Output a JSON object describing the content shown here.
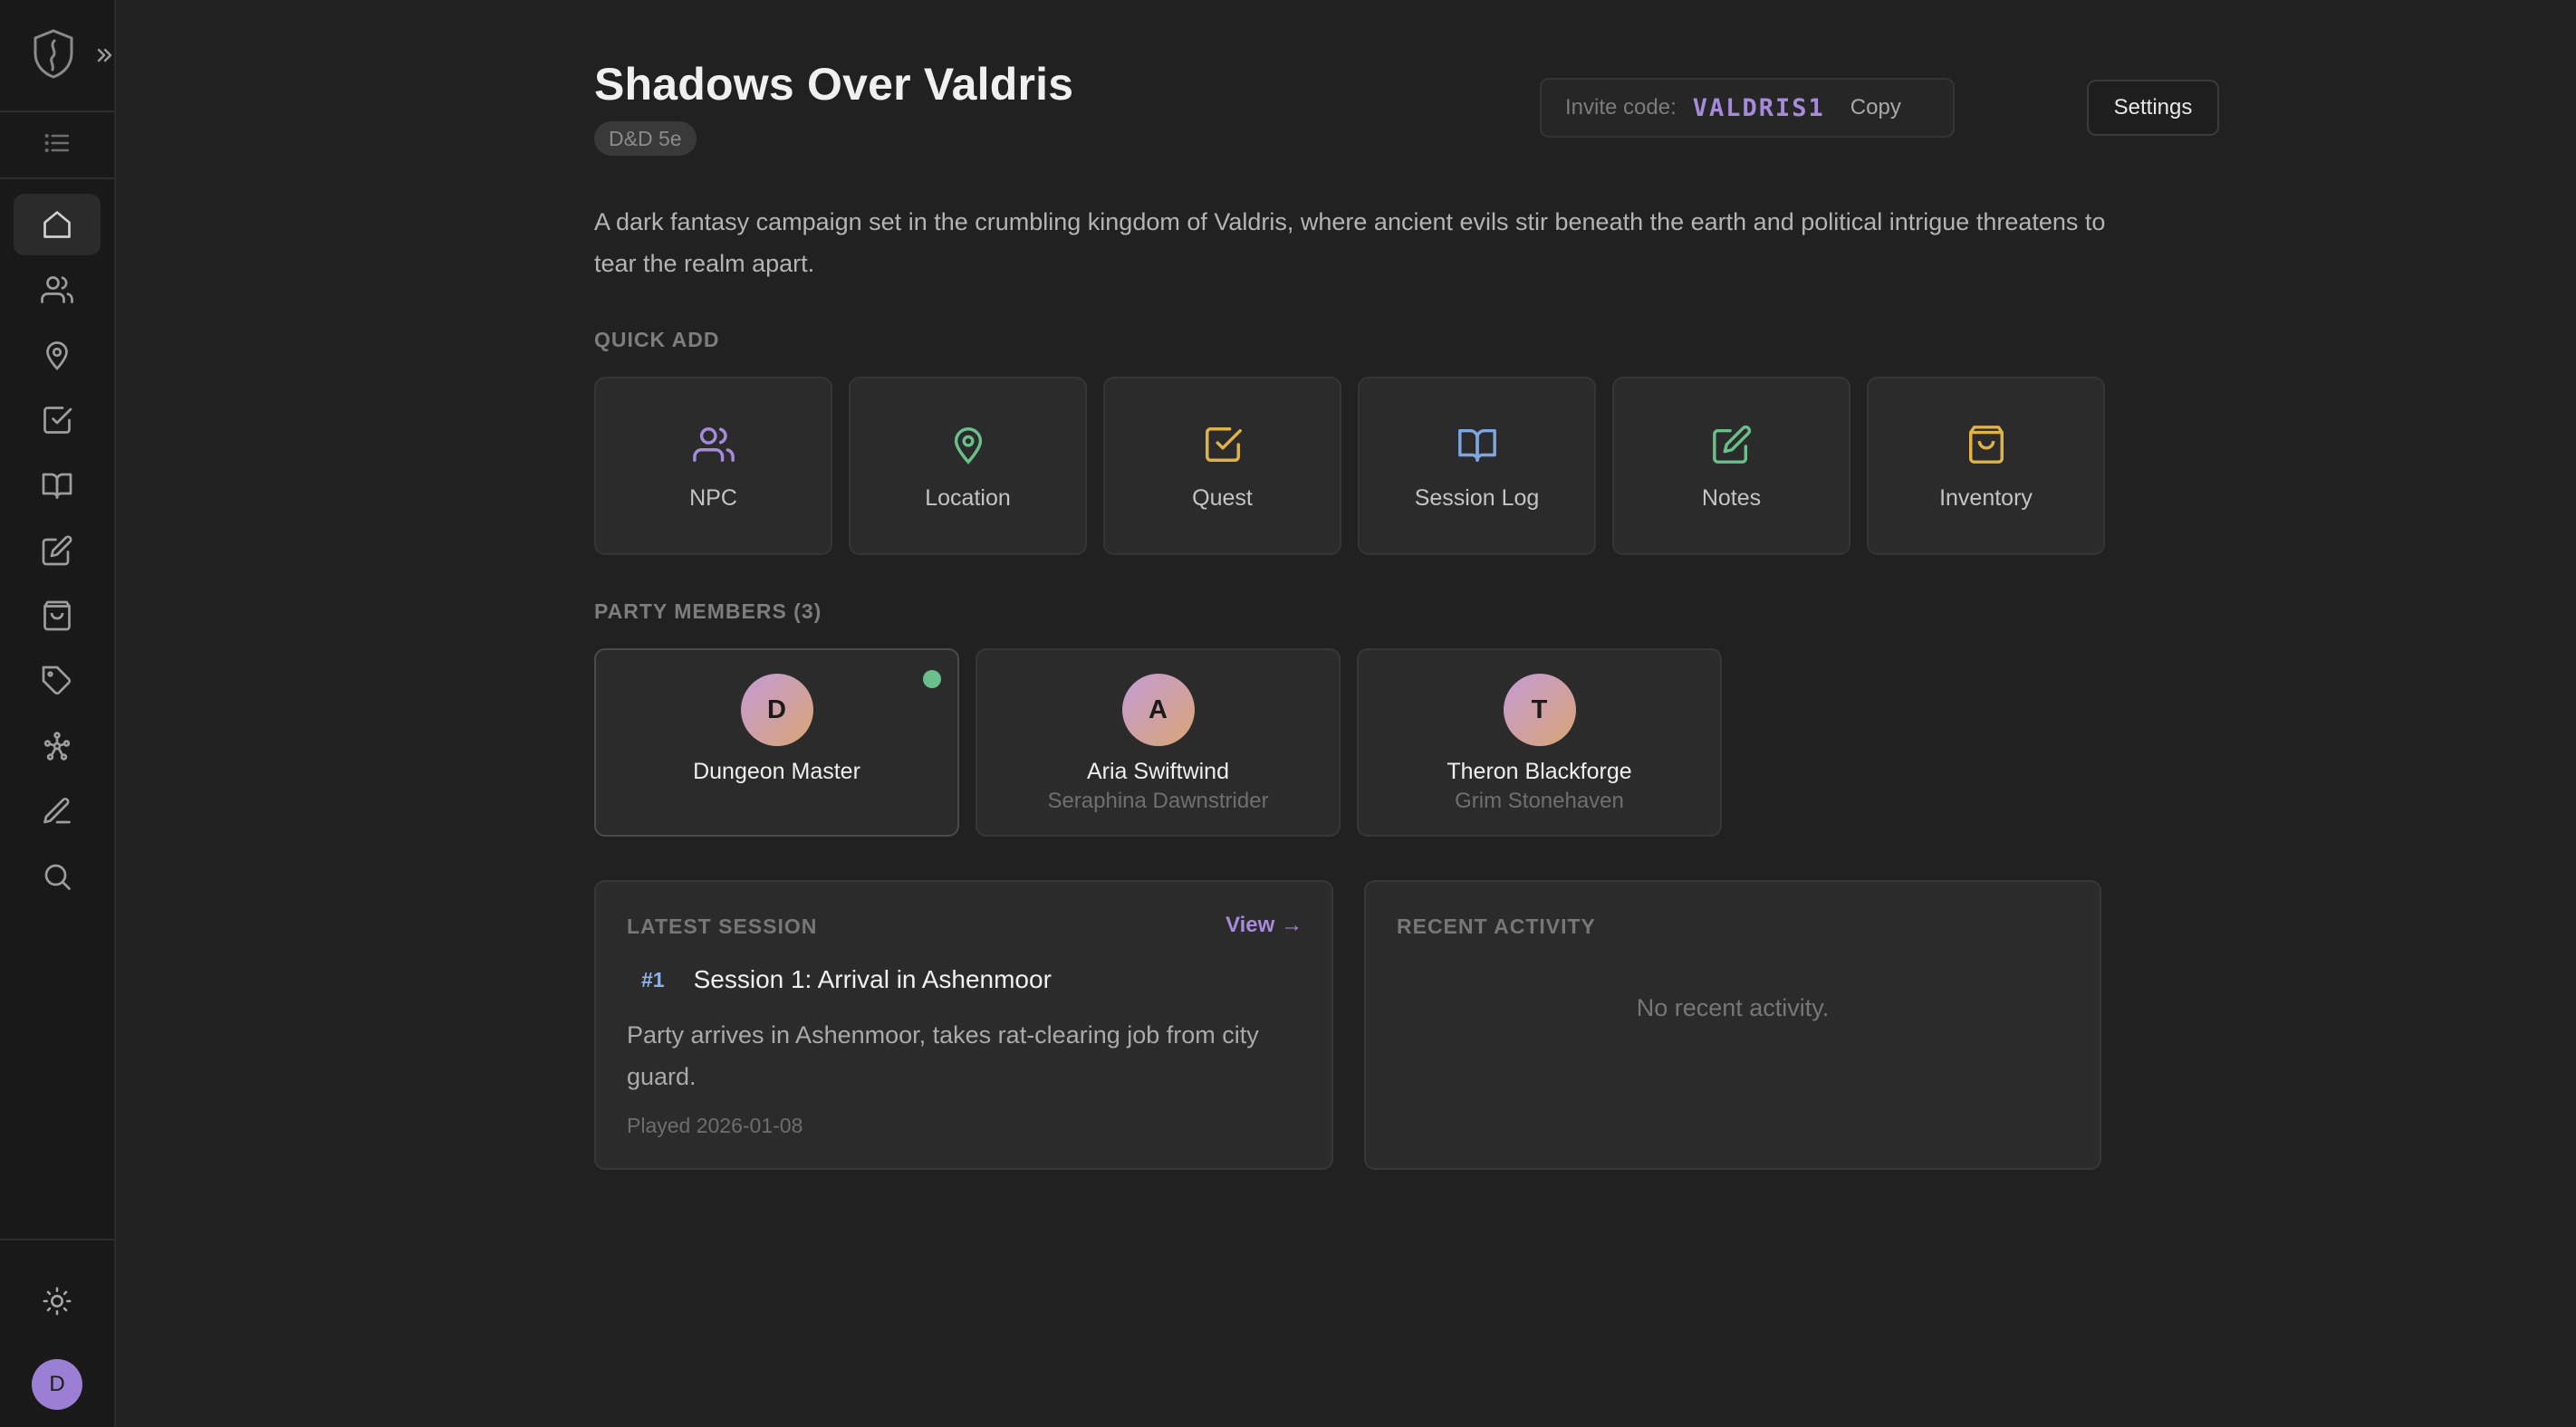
{
  "campaign": {
    "title": "Shadows Over Valdris",
    "system": "D&D 5e",
    "description": "A dark fantasy campaign set in the crumbling kingdom of Valdris, where ancient evils stir beneath the earth and political intrigue threatens to tear the realm apart."
  },
  "invite": {
    "label": "Invite code:",
    "code": "VALDRIS1",
    "copy_label": "Copy"
  },
  "settings_label": "Settings",
  "quick_add": {
    "label": "QUICK ADD",
    "items": [
      {
        "label": "NPC",
        "icon": "users-icon",
        "color": "#a78bdb"
      },
      {
        "label": "Location",
        "icon": "map-pin-icon",
        "color": "#6bbf8a"
      },
      {
        "label": "Quest",
        "icon": "check-square-icon",
        "color": "#e0b24a"
      },
      {
        "label": "Session Log",
        "icon": "book-open-icon",
        "color": "#7fa6e0"
      },
      {
        "label": "Notes",
        "icon": "edit-icon",
        "color": "#6bbf8a"
      },
      {
        "label": "Inventory",
        "icon": "shopping-bag-icon",
        "color": "#e0b24a"
      }
    ]
  },
  "party": {
    "label": "PARTY MEMBERS (3)",
    "members": [
      {
        "initial": "D",
        "name": "Dungeon Master",
        "character": "",
        "online": true
      },
      {
        "initial": "A",
        "name": "Aria Swiftwind",
        "character": "Seraphina Dawnstrider",
        "online": false
      },
      {
        "initial": "T",
        "name": "Theron Blackforge",
        "character": "Grim Stonehaven",
        "online": false
      }
    ]
  },
  "latest_session": {
    "label": "LATEST SESSION",
    "view_label": "View →",
    "number": "#1",
    "title": "Session 1: Arrival in Ashenmoor",
    "summary": "Party arrives in Ashenmoor, takes rat-clearing job from city guard.",
    "played": "Played 2026-01-08"
  },
  "recent_activity": {
    "label": "RECENT ACTIVITY",
    "empty_text": "No recent activity."
  },
  "sidebar": {
    "nav": [
      "home-icon",
      "users-icon",
      "map-pin-icon",
      "check-square-icon",
      "book-open-icon",
      "edit-icon",
      "shopping-bag-icon",
      "tag-icon",
      "graph-icon",
      "pen-icon",
      "search-icon"
    ],
    "user_initial": "D"
  },
  "colors": {
    "accent": "#a78bdb",
    "online": "#6bbf8a"
  }
}
